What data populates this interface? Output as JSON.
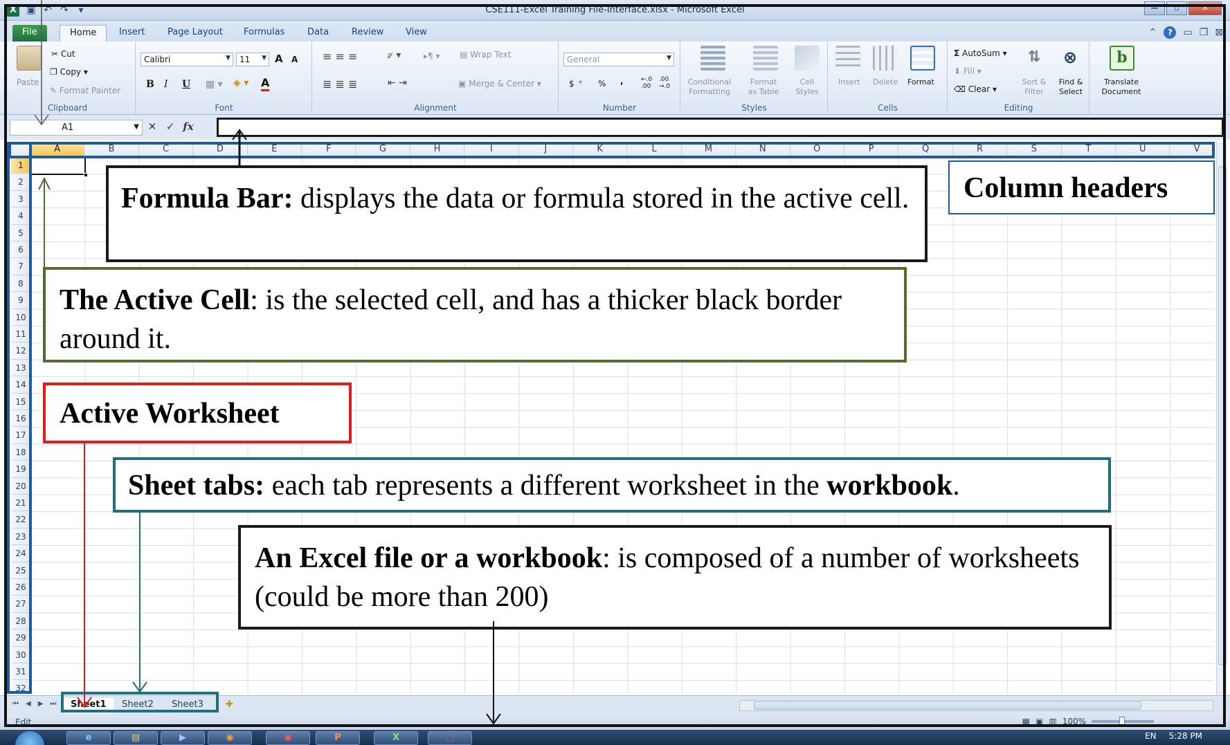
{
  "window": {
    "title": "CSE111-Excel Training File-Interface.xlsx - Microsoft Excel",
    "app_icon": "X",
    "qat_icons": [
      "save-icon",
      "undo-icon",
      "redo-icon",
      "customize-icon"
    ],
    "controls": [
      "minimize-icon",
      "restore-icon",
      "close-icon"
    ]
  },
  "ribbon_tabs": [
    "File",
    "Home",
    "Insert",
    "Page Layout",
    "Formulas",
    "Data",
    "Review",
    "View"
  ],
  "ribbon": {
    "clipboard": {
      "label": "Clipboard",
      "paste": "Paste",
      "cut": "Cut",
      "copy": "Copy",
      "format_painter": "Format Painter"
    },
    "font": {
      "label": "Font",
      "font_name": "Calibri",
      "font_size": "11",
      "bold": "B",
      "italic": "I",
      "underline": "U",
      "grow": "A",
      "shrink": "A"
    },
    "alignment": {
      "label": "Alignment",
      "wrap_text": "Wrap Text",
      "merge_center": "Merge & Center"
    },
    "number": {
      "label": "Number",
      "format": "General",
      "currency": "$",
      "percent": "%",
      "comma": ",",
      "inc_decimal": "←.0 .00",
      "dec_decimal": ".00 →.0"
    },
    "styles": {
      "label": "Styles",
      "conditional_formatting": [
        "Conditional",
        "Formatting"
      ],
      "format_as_table": [
        "Format",
        "as Table"
      ],
      "cell_styles": [
        "Cell",
        "Styles"
      ]
    },
    "cells": {
      "label": "Cells",
      "insert": "Insert",
      "delete": "Delete",
      "format": "Format"
    },
    "editing": {
      "label": "Editing",
      "autosum": "AutoSum",
      "fill": "Fill",
      "clear": "Clear",
      "sort_filter": [
        "Sort &",
        "Filter"
      ],
      "find_select": [
        "Find &",
        "Select"
      ]
    },
    "translate": {
      "line1": "Translate",
      "line2": "Document"
    }
  },
  "formula_bar": {
    "name_box": "A1",
    "cancel": "✕",
    "enter": "✓",
    "fx": "fx",
    "content": ""
  },
  "columns": [
    "A",
    "B",
    "C",
    "D",
    "E",
    "F",
    "G",
    "H",
    "I",
    "J",
    "K",
    "L",
    "M",
    "N",
    "O",
    "P",
    "Q",
    "R",
    "S",
    "T",
    "U",
    "V"
  ],
  "rows": [
    "1",
    "2",
    "3",
    "4",
    "5",
    "6",
    "7",
    "8",
    "9",
    "10",
    "11",
    "12",
    "13",
    "14",
    "15",
    "16",
    "17",
    "18",
    "19",
    "20",
    "21",
    "22",
    "23",
    "24",
    "25",
    "26",
    "27",
    "28",
    "29",
    "30",
    "31",
    "32"
  ],
  "active_cell": "A1",
  "sheet_tabs": [
    "Sheet1",
    "Sheet2",
    "Sheet3"
  ],
  "active_sheet": "Sheet1",
  "status": {
    "mode": "Edit",
    "zoom": "100%"
  },
  "taskbar": {
    "lang": "EN",
    "time": "5:28 PM"
  },
  "annotations": {
    "formula_bar": {
      "bold": "Formula Bar:",
      "text": " displays the data or formula stored in the active cell."
    },
    "column_headers": {
      "bold": "Column headers"
    },
    "active_cell": {
      "bold": "The Active Cell",
      "text": ": is the selected cell, and has a thicker black border around it."
    },
    "active_worksheet": {
      "bold": "Active Worksheet"
    },
    "sheet_tabs": {
      "bold": "Sheet tabs:",
      "text": " each tab represents a different worksheet in the ",
      "bold2": "workbook",
      "end": "."
    },
    "workbook": {
      "bold": "An Excel file or a workbook",
      "text": ": is composed of a number of worksheets (could be more than 200)"
    }
  },
  "colors": {
    "formula_callout": "#1a1a1a",
    "column_callout": "#1e5aa0",
    "active_cell_callout": "#556b2f",
    "active_sheet_callout": "#e31b1b",
    "sheet_tabs_callout": "#1f6e82",
    "excel_green": "#1e7145"
  }
}
